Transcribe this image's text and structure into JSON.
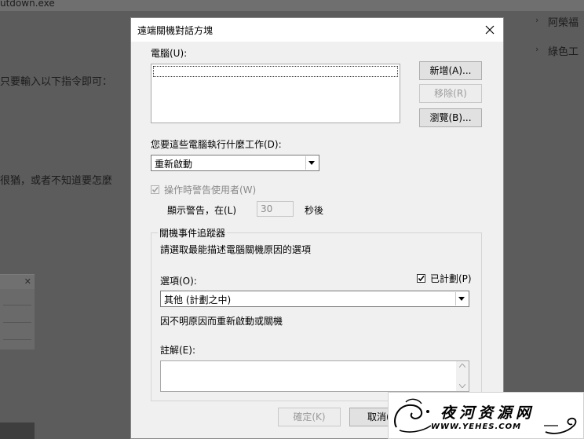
{
  "background": {
    "file_name": "utdown.exe",
    "line1": "只要輸入以下指令即可：",
    "line2": "很猶，或者不知道要怎麼",
    "side_items": [
      "阿榮福",
      "綠色工"
    ]
  },
  "dialog": {
    "title": "遠端關機對話方塊",
    "computer_label": "電腦(U):",
    "computers": [],
    "buttons": {
      "add": "新增(A)...",
      "remove": "移除(R)",
      "browse": "瀏覽(B)..."
    },
    "action_label": "您要這些電腦執行什麼工作(D):",
    "action_value": "重新啟動",
    "warn_checkbox_label": "操作時警告使用者(W)",
    "warn_checked": true,
    "warn_enabled": false,
    "display_warning_label": "顯示警告，在(L)",
    "warning_seconds": "30",
    "seconds_unit": "秒後",
    "tracker": {
      "title": "關機事件追蹤器",
      "instruction": "請選取最能描述電腦關機原因的選項",
      "option_label": "選項(O):",
      "planned_label": "已計劃(P)",
      "planned_checked": true,
      "option_value": "其他 (計劃之中)",
      "option_description": "因不明原因而重新啟動或關機",
      "comment_label": "註解(E):",
      "comment_value": ""
    },
    "ok_label": "確定(K)",
    "cancel_label": "取消("
  },
  "watermark": {
    "text": "夜河资源网",
    "url": "WWW.YEHES.COM"
  }
}
